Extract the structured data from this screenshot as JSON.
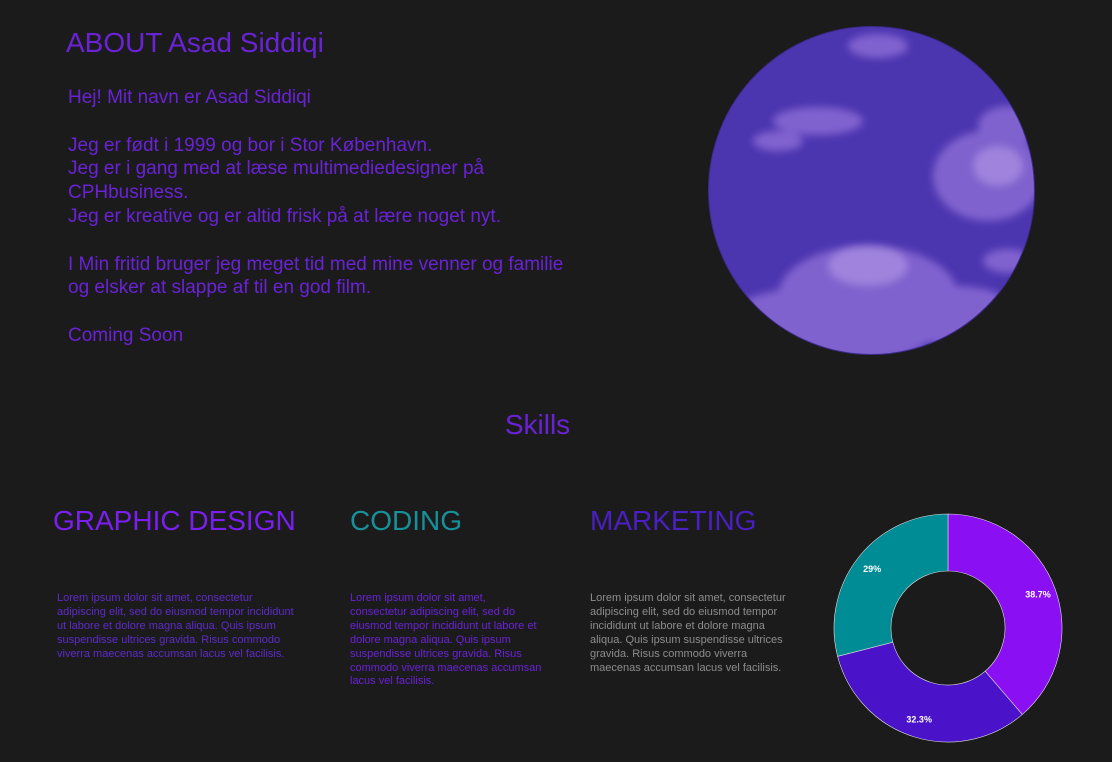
{
  "about": {
    "title": "ABOUT Asad Siddiqi",
    "greeting": "Hej! Mit navn er Asad Siddiqi",
    "bio_line1": "Jeg er født i 1999 og bor i Stor København.",
    "bio_line2": "Jeg er i gang med at læse multimediedesigner på CPHbusiness.",
    "bio_line3": "Jeg er kreative og er altid frisk på at lære noget nyt.",
    "freetime": "I Min fritid bruger jeg meget tid med mine venner og familie og elsker at slappe af til en god film.",
    "coming_soon": "Coming Soon"
  },
  "skills": {
    "title": "Skills",
    "items": [
      {
        "heading": "GRAPHIC DESIGN",
        "text": "Lorem ipsum dolor sit amet, consectetur adipiscing elit, sed do eiusmod tempor incididunt ut labore et dolore magna aliqua. Quis ipsum suspendisse ultrices gravida. Risus commodo viverra maecenas accumsan lacus vel facilisis."
      },
      {
        "heading": "CODING",
        "text": "Lorem ipsum dolor sit amet, consectetur adipiscing elit, sed do eiusmod tempor incididunt ut labore et dolore magna aliqua. Quis ipsum suspendisse ultrices gravida. Risus commodo viverra maecenas accumsan lacus vel facilisis."
      },
      {
        "heading": "MARKETING",
        "text": "Lorem ipsum dolor sit amet, consectetur adipiscing elit, sed do eiusmod tempor incididunt ut labore et dolore magna aliqua. Quis ipsum suspendisse ultrices gravida. Risus commodo viverra maecenas accumsan lacus vel facilisis."
      }
    ]
  },
  "colors": {
    "background": "#1b1b1b",
    "accent_purple": "#6a22d6",
    "graphic": "#7b1ff0",
    "coding": "#17909a",
    "marketing": "#4a1fc4"
  },
  "chart_data": {
    "type": "pie",
    "variant": "donut",
    "slices": [
      {
        "label": "38.7%",
        "value": 38.7,
        "color": "#8a0ff2"
      },
      {
        "label": "32.3%",
        "value": 32.3,
        "color": "#4a12c9"
      },
      {
        "label": "29%",
        "value": 29.0,
        "color": "#008c95"
      }
    ],
    "start": "top",
    "direction": "clockwise"
  }
}
